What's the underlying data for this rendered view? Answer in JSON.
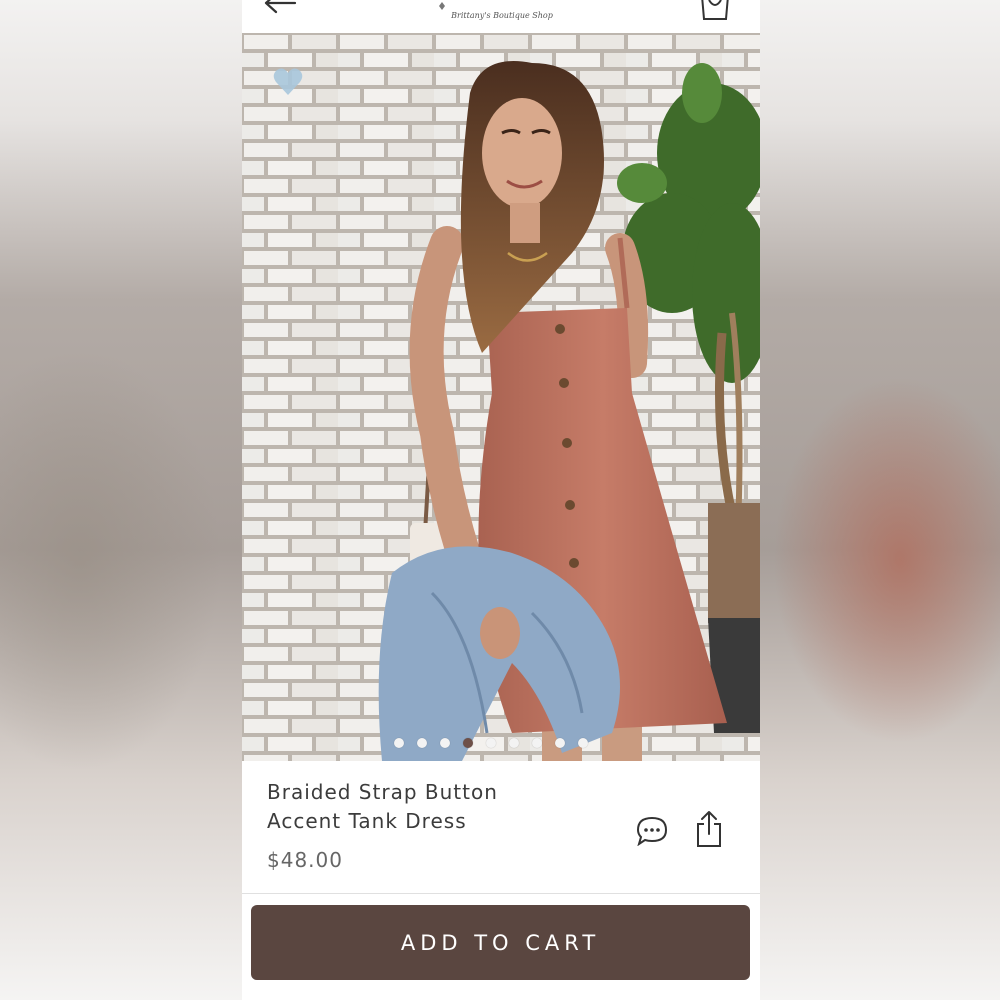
{
  "header": {
    "logo_text": "Brittany's Boutique Shop"
  },
  "product": {
    "title_line1": "Braided Strap Button",
    "title_line2": "Accent Tank Dress",
    "price": "$48.00",
    "image_count": 9,
    "active_image_index": 3
  },
  "actions": {
    "add_to_cart_label": "ADD TO CART"
  },
  "icons": {
    "back": "back-arrow-icon",
    "bag": "shopping-bag-icon",
    "favorite": "heart-icon",
    "comments": "chat-bubble-icon",
    "share": "share-icon"
  },
  "colors": {
    "cart_button": "#5a4640",
    "favorite_heart": "#a9c6dc",
    "dress": "#c07764",
    "active_dot": "#6e5048"
  }
}
